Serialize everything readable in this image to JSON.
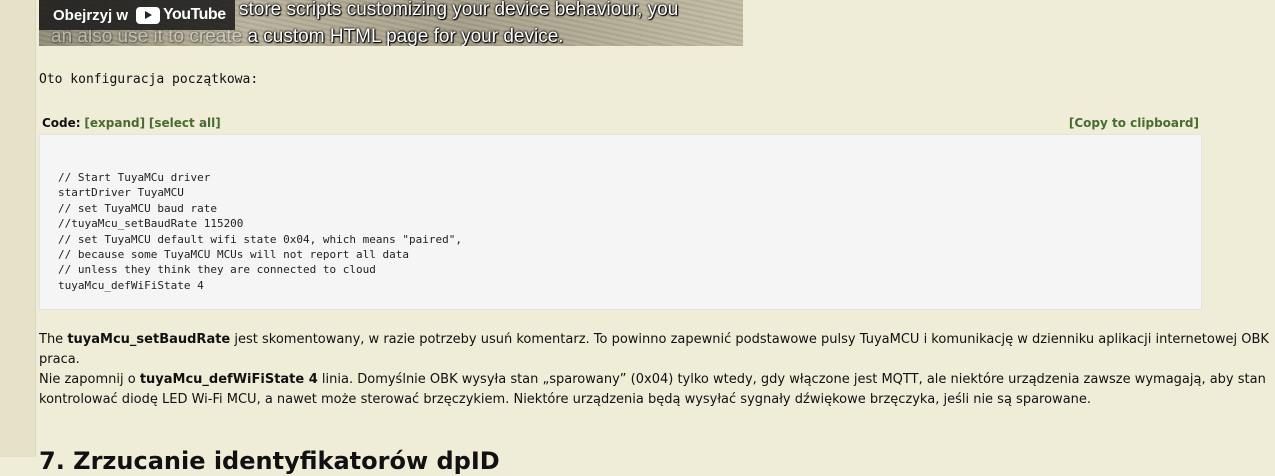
{
  "video": {
    "caption_line1": "store scripts customizing your device behaviour, you",
    "caption_line2_faded": "an also use it to create",
    "caption_line2": " a custom HTML page for your device.",
    "watch_label": "Obejrzyj w",
    "youtube_label": "YouTube"
  },
  "intro": "Oto konfiguracja początkowa:",
  "code_block": {
    "label": "Code:",
    "expand": "[expand]",
    "select_all": "[select all]",
    "copy": "[Copy to clipboard]",
    "lines": [
      "// Start TuyaMCu driver",
      "startDriver TuyaMCU",
      "// set TuyaMCU baud rate",
      "//tuyaMcu_setBaudRate 115200",
      "// set TuyaMCU default wifi state 0x04, which means \"paired\",",
      "// because some TuyaMCU MCUs will not report all data",
      "// unless they think they are connected to cloud",
      "tuyaMcu_defWiFiState 4"
    ]
  },
  "para1": {
    "pre": "The ",
    "bold": "tuyaMcu_setBaudRate",
    "post": " jest skomentowany, w razie potrzeby usuń komentarz. To powinno zapewnić podstawowe pulsy TuyaMCU i komunikację w dzienniku aplikacji internetowej OBK",
    "line2": "praca."
  },
  "para2": {
    "pre": "Nie zapomnij o ",
    "bold": "tuyaMcu_defWiFiState 4",
    "post": " linia. Domyślnie OBK wysyła stan „sparowany” (0x04) tylko wtedy, gdy włączone jest MQTT, ale niektóre urządzenia zawsze wymagają, aby stan",
    "line2": "kontrolować diodę LED Wi-Fi MCU, a nawet może sterować brzęczykiem. Niektóre urządzenia będą wysyłać sygnały dźwiękowe brzęczyka, jeśli nie są sparowane."
  },
  "next_heading": "7. Zrzucanie identyfikatorów dpID"
}
